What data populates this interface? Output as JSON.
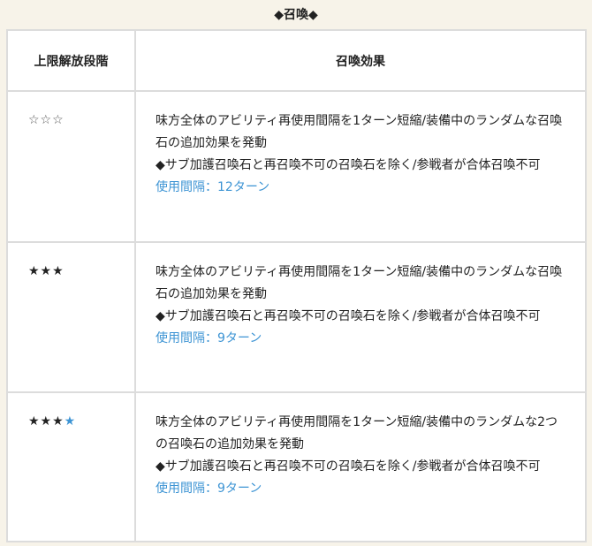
{
  "section": {
    "title": "◆召喚◆"
  },
  "table": {
    "headers": [
      "上限解放段階",
      "召喚効果"
    ],
    "rows": [
      {
        "stars": "☆☆☆",
        "extra_star": "",
        "effect_line1": "味方全体のアビリティ再使用間隔を1ターン短縮/装備中のランダムな召喚石の追加効果を発動",
        "effect_line2": "◆サブ加護召喚石と再召喚不可の召喚石を除く/参戦者が合体召喚不可",
        "interval": "使用間隔：12ターン"
      },
      {
        "stars": "★★★",
        "extra_star": "",
        "effect_line1": "味方全体のアビリティ再使用間隔を1ターン短縮/装備中のランダムな召喚石の追加効果を発動",
        "effect_line2": "◆サブ加護召喚石と再召喚不可の召喚石を除く/参戦者が合体召喚不可",
        "interval": "使用間隔：9ターン"
      },
      {
        "stars": "★★★",
        "extra_star": "★",
        "effect_line1": "味方全体のアビリティ再使用間隔を1ターン短縮/装備中のランダムな2つの召喚石の追加効果を発動",
        "effect_line2": "◆サブ加護召喚石と再召喚不可の召喚石を除く/参戦者が合体召喚不可",
        "interval": "使用間隔：9ターン"
      }
    ]
  },
  "colors": {
    "accent_blue": "#3d94d4",
    "border": "#dcdcdc",
    "page_background": "#f7f3e9"
  }
}
